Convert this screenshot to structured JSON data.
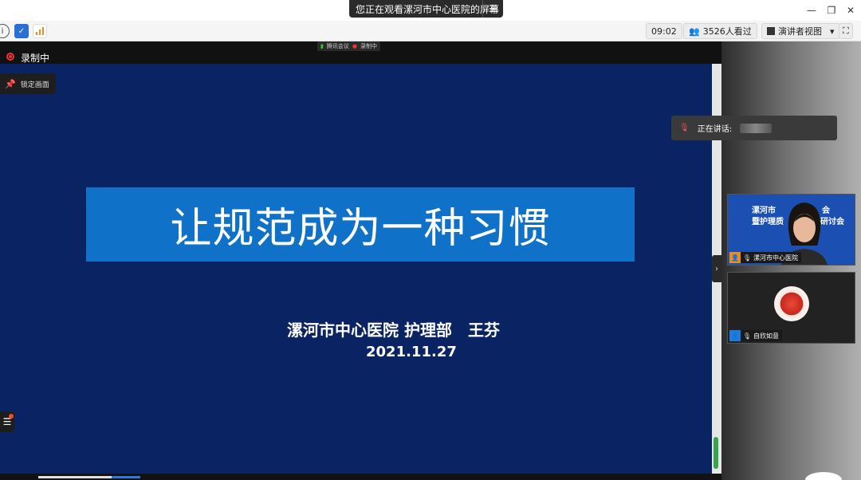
{
  "window": {
    "share_banner": "您正在观看漯河市中心医院的屏幕",
    "menu_icon": "menu-icon",
    "minimize": "—",
    "restore": "❐",
    "close": "✕"
  },
  "toolbar": {
    "time": "09:02",
    "viewers": "3526人看过",
    "view_mode": "演讲者视图",
    "dropdown": "▾",
    "fullscreen": "⛶"
  },
  "stage": {
    "recording_label": "录制中",
    "meeting_app": "腾讯会议",
    "meeting_recording": "录制中",
    "lock_label": "锁定画面"
  },
  "slide": {
    "title": "让规范成为一种习惯",
    "author": "漯河市中心医院 护理部　王芬",
    "date": "2021.11.27"
  },
  "speaking": {
    "label": "正在讲话:"
  },
  "participants": [
    {
      "name": "漯河市中心医院",
      "banner_line1": "漯河市",
      "banner_line1b": "会",
      "banner_line2": "暨护理质",
      "banner_line2b": "研讨会"
    },
    {
      "name": "自欣如意"
    }
  ],
  "colors": {
    "slide_bg": "#0a2463",
    "title_box": "#0f72c8",
    "record_red": "#e33333"
  }
}
